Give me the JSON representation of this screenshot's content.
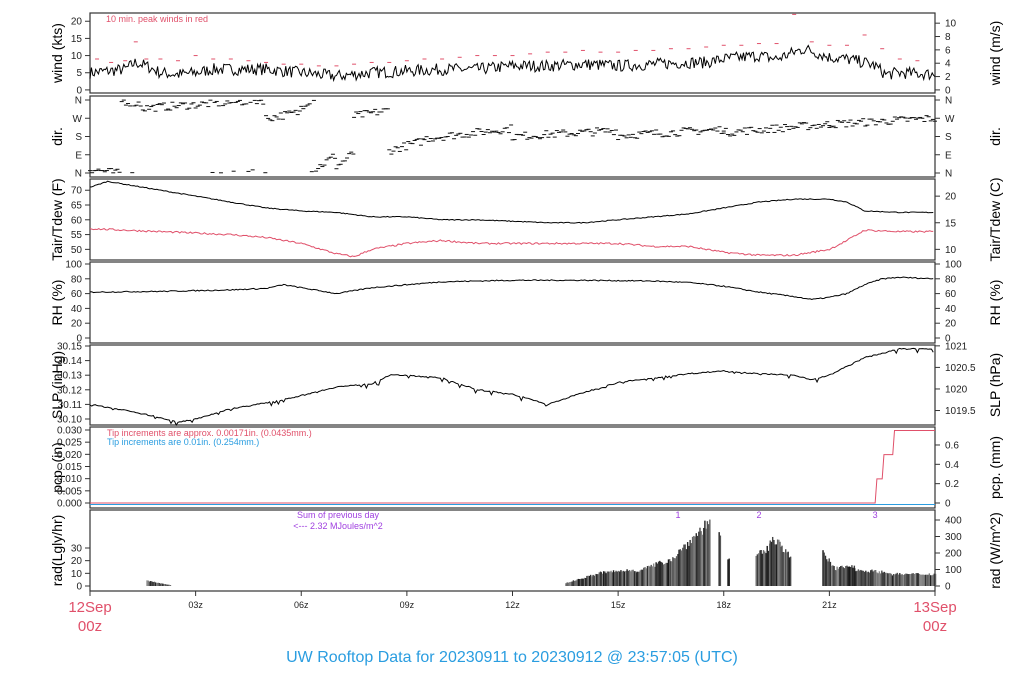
{
  "title": "UW Rooftop Data for 20230911  to  20230912 @ 23:57:05  (UTC)",
  "colors": {
    "red": "#e0506a",
    "blue": "#2a9de0",
    "purple": "#a040e0",
    "line": "#000000"
  },
  "chart_data": [
    {
      "type": "line",
      "name": "wind",
      "ylabel": "wind (kts)",
      "ylabel_right": "wind (m/s)",
      "annotation": "10 min. peak winds in red",
      "ylim": [
        -0.9,
        22.4
      ],
      "yticks": [
        0,
        5,
        10,
        15,
        20
      ],
      "yticks_right": [
        0,
        2,
        4,
        6,
        8,
        10
      ],
      "series": [
        {
          "name": "wind",
          "x": [
            0,
            0.5,
            1,
            1.3,
            1.6,
            2,
            2.5,
            3,
            3.5,
            4,
            5,
            6,
            6.5,
            7,
            7.5,
            8,
            9,
            10,
            11,
            12,
            13,
            14,
            15,
            16,
            17,
            17.5,
            18,
            18.5,
            19,
            19.5,
            20,
            20.3,
            21,
            21.5,
            22,
            22.3,
            22.6,
            23,
            24
          ],
          "y": [
            5,
            5.5,
            6,
            8,
            7,
            5,
            4.5,
            5,
            6,
            6,
            6,
            5,
            4.5,
            4,
            4.5,
            5,
            5.5,
            6,
            6,
            7,
            7,
            7.5,
            7,
            7.5,
            8,
            8,
            9,
            9.5,
            10,
            9,
            11,
            12,
            9.5,
            9,
            8,
            7,
            4.5,
            5,
            4.5
          ]
        },
        {
          "name": "peak",
          "x": [
            0.2,
            0.6,
            1,
            1.3,
            1.6,
            2,
            2.5,
            3,
            3.5,
            4,
            4.5,
            5,
            5.5,
            6,
            6.5,
            7,
            7.5,
            8,
            8.5,
            9,
            9.5,
            10,
            10.5,
            11,
            11.5,
            12,
            12.5,
            13,
            13.5,
            14,
            14.5,
            15,
            15.5,
            16,
            16.5,
            17,
            17.5,
            18,
            18.5,
            19,
            19.5,
            20,
            20.5,
            21,
            21.5,
            22,
            22.5,
            23,
            23.5
          ],
          "y": [
            9,
            8,
            8.5,
            14,
            9,
            9,
            8.5,
            10,
            9,
            9,
            8.5,
            8,
            7.5,
            7.5,
            7,
            7,
            7.5,
            8,
            8,
            8.5,
            9,
            9,
            9.5,
            10,
            10,
            10,
            10.5,
            11,
            11,
            11.5,
            11,
            11,
            11.5,
            11.5,
            12,
            12,
            12.5,
            13,
            13,
            13.5,
            13.5,
            22,
            14,
            13,
            13,
            16,
            12,
            9,
            8.5
          ]
        }
      ]
    },
    {
      "type": "scatter",
      "name": "dir",
      "ylabel": "dir.",
      "ylabel_right": "dir.",
      "yticks": [
        0,
        90,
        180,
        270,
        360
      ],
      "ytick_labels": [
        "N",
        "E",
        "S",
        "W",
        "N"
      ],
      "segments": [
        [
          0,
          1.5,
          20,
          340
        ],
        [
          1.5,
          5,
          320,
          360
        ],
        [
          5,
          6,
          270,
          300
        ],
        [
          6,
          7,
          330,
          90
        ],
        [
          7,
          7.5,
          30,
          100
        ],
        [
          7.5,
          8.5,
          280,
          310
        ],
        [
          8.5,
          9.5,
          110,
          160
        ],
        [
          9.5,
          12,
          170,
          220
        ],
        [
          12,
          15,
          180,
          210
        ],
        [
          15,
          18,
          185,
          215
        ],
        [
          18,
          21,
          200,
          240
        ],
        [
          21,
          24,
          240,
          270
        ]
      ]
    },
    {
      "type": "line",
      "name": "temp",
      "ylabel": "Tair/Tdew (F)",
      "ylabel_right": "Tair/Tdew (C)",
      "ylim": [
        46.4,
        73.8
      ],
      "yticks": [
        50,
        55,
        60,
        65,
        70
      ],
      "yticks_right": [
        10,
        15,
        20
      ],
      "series": [
        {
          "name": "Tair",
          "x": [
            0,
            0.5,
            1,
            2,
            3,
            4,
            5,
            6,
            7,
            8,
            9,
            10,
            11,
            12,
            13,
            14,
            15,
            16,
            17,
            18,
            19,
            20,
            21,
            21.5,
            22,
            23,
            24
          ],
          "y": [
            71,
            73,
            72,
            70,
            68,
            66,
            64,
            63,
            62.5,
            61,
            61,
            60,
            60,
            59.5,
            59,
            59,
            60,
            61,
            62,
            64,
            66,
            67,
            67,
            66,
            63,
            62.5,
            62.5
          ]
        },
        {
          "name": "Tdew",
          "x": [
            0,
            2,
            4,
            5,
            6,
            7,
            7.5,
            8,
            9,
            10,
            11,
            12,
            14,
            15,
            16,
            17,
            18,
            19,
            20,
            21,
            21.5,
            22,
            23,
            24
          ],
          "y": [
            57,
            56,
            55,
            54,
            52,
            48.5,
            47.5,
            50,
            52,
            53,
            52,
            52,
            52,
            52,
            51,
            51,
            49,
            48,
            48,
            50,
            53,
            56.5,
            56,
            56
          ]
        }
      ]
    },
    {
      "type": "line",
      "name": "rh",
      "ylabel": "RH (%)",
      "ylabel_right": "RH (%)",
      "ylim": [
        0,
        100
      ],
      "yticks": [
        0,
        20,
        40,
        60,
        80,
        100
      ],
      "series": [
        {
          "name": "RH",
          "x": [
            0,
            2,
            4,
            5,
            5.5,
            6,
            7,
            8,
            9,
            10,
            12,
            14,
            16,
            17,
            18,
            19,
            20,
            20.5,
            21,
            21.5,
            22,
            22.5,
            23,
            24
          ],
          "y": [
            62,
            63,
            65,
            67,
            72,
            68,
            60,
            68,
            72,
            76,
            78,
            78,
            77,
            75,
            70,
            62,
            56,
            52,
            55,
            60,
            72,
            80,
            82,
            80
          ]
        }
      ]
    },
    {
      "type": "line",
      "name": "slp",
      "ylabel": "SLP (inHg)",
      "ylabel_right": "SLP (hPa)",
      "ylim": [
        30.097,
        30.151
      ],
      "yticks": [
        30.1,
        30.11,
        30.12,
        30.13,
        30.14,
        30.15
      ],
      "ytick_labels": [
        "30.10",
        "30.11",
        "30.12",
        "30.13",
        "30.14",
        "30.15"
      ],
      "yticks_right_hpa": [
        1019.5,
        1020,
        1020.5,
        1021
      ],
      "series": [
        {
          "name": "SLP",
          "x": [
            0,
            1,
            2,
            2.5,
            3,
            4,
            5,
            6,
            7,
            8,
            8.5,
            9,
            10,
            11,
            12,
            13,
            14,
            15,
            16,
            17,
            18,
            19,
            20,
            20.5,
            21,
            22,
            23,
            24
          ],
          "y": [
            30.11,
            30.106,
            30.101,
            30.098,
            30.1,
            30.107,
            30.111,
            30.116,
            30.122,
            30.124,
            30.13,
            30.13,
            30.128,
            30.12,
            30.117,
            30.11,
            30.118,
            30.125,
            30.128,
            30.131,
            30.133,
            30.131,
            30.13,
            30.127,
            30.13,
            30.142,
            30.148,
            30.148
          ]
        }
      ]
    },
    {
      "type": "line",
      "name": "pcp",
      "ylabel": "pcp. (in)",
      "ylabel_right": "pcp. (mm)",
      "note_red": "Tip increments are approx. 0.00171in. (0.0435mm.)",
      "note_blue": "Tip increments are 0.01in. (0.254mm.)",
      "ylim_in": [
        -0.0005,
        0.031
      ],
      "yticks": [
        0,
        0.005,
        0.01,
        0.015,
        0.02,
        0.025,
        0.03
      ],
      "ytick_labels": [
        "0.000",
        "0.005",
        "0.010",
        "0.015",
        "0.020",
        "0.025",
        "0.030"
      ],
      "yticks_right": [
        0,
        0.2,
        0.4,
        0.6
      ],
      "series": [
        {
          "name": "cumulative pcp (mm)",
          "x": [
            0,
            22.3,
            22.35,
            22.5,
            22.55,
            22.8,
            22.85,
            24
          ],
          "y": [
            0,
            0,
            0.25,
            0.25,
            0.5,
            0.5,
            0.75,
            0.75
          ]
        }
      ]
    },
    {
      "type": "bar",
      "name": "rad",
      "ylabel": "rad(Lgly/hr)",
      "ylabel_right": "rad (W/m^2)",
      "ylim_w": [
        -20,
        480
      ],
      "yticks_left": [
        0,
        10,
        20,
        30
      ],
      "yticks_right": [
        0,
        100,
        200,
        300,
        400
      ],
      "sum_label": "Sum of previous day",
      "sum_value": "<--- 2.32 MJoules/m^2",
      "markers": [
        {
          "label": "1",
          "x": 16.7
        },
        {
          "label": "2",
          "x": 19.0
        },
        {
          "label": "3",
          "x": 22.3
        }
      ],
      "envelope": [
        [
          1.6,
          2.3,
          35,
          5
        ],
        [
          13.5,
          14.5,
          20,
          90
        ],
        [
          14.5,
          15.5,
          90,
          110
        ],
        [
          15.5,
          16.5,
          100,
          180
        ],
        [
          16.5,
          17.6,
          180,
          440
        ],
        [
          17.85,
          17.9,
          370,
          370
        ],
        [
          18.1,
          18.15,
          170,
          170
        ],
        [
          18.9,
          19.3,
          200,
          260
        ],
        [
          19.3,
          19.6,
          300,
          320
        ],
        [
          19.6,
          19.9,
          280,
          180
        ],
        [
          20.8,
          21.2,
          220,
          100
        ],
        [
          21.2,
          21.7,
          120,
          140
        ],
        [
          21.7,
          22.7,
          110,
          90
        ],
        [
          22.7,
          24,
          80,
          80
        ]
      ]
    }
  ],
  "xaxis": {
    "ticks": [
      {
        "h": 3,
        "label": "03z"
      },
      {
        "h": 6,
        "label": "06z"
      },
      {
        "h": 9,
        "label": "09z"
      },
      {
        "h": 12,
        "label": "12z"
      },
      {
        "h": 15,
        "label": "15z"
      },
      {
        "h": 18,
        "label": "18z"
      },
      {
        "h": 21,
        "label": "21z"
      }
    ],
    "start_date": "12Sep",
    "start_time": "00z",
    "end_date": "13Sep",
    "end_time": "00z"
  }
}
